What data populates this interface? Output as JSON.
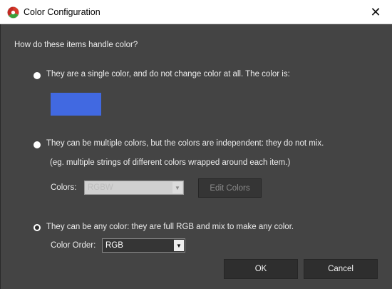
{
  "window": {
    "title": "Color Configuration",
    "close_glyph": "✕",
    "icon": "app-logo-icon"
  },
  "dialog": {
    "question": "How do these items handle color?",
    "options": [
      {
        "label": "They are a single color, and do not change color at all. The color is:",
        "selected": false
      },
      {
        "label": "They can be multiple colors, but the colors are independent: they do not mix.",
        "note": "(eg. multiple strings of different colors wrapped around each item.)",
        "selected": false
      },
      {
        "label": "They can be any color: they are full RGB and mix to make any color.",
        "selected": true
      }
    ],
    "single_color_swatch": "#4169e1",
    "colors_label": "Colors:",
    "colors_value": "RGBW",
    "colors_enabled": false,
    "edit_colors_label": "Edit Colors",
    "color_order_label": "Color Order:",
    "color_order_value": "RGB",
    "ok_label": "OK",
    "cancel_label": "Cancel"
  }
}
